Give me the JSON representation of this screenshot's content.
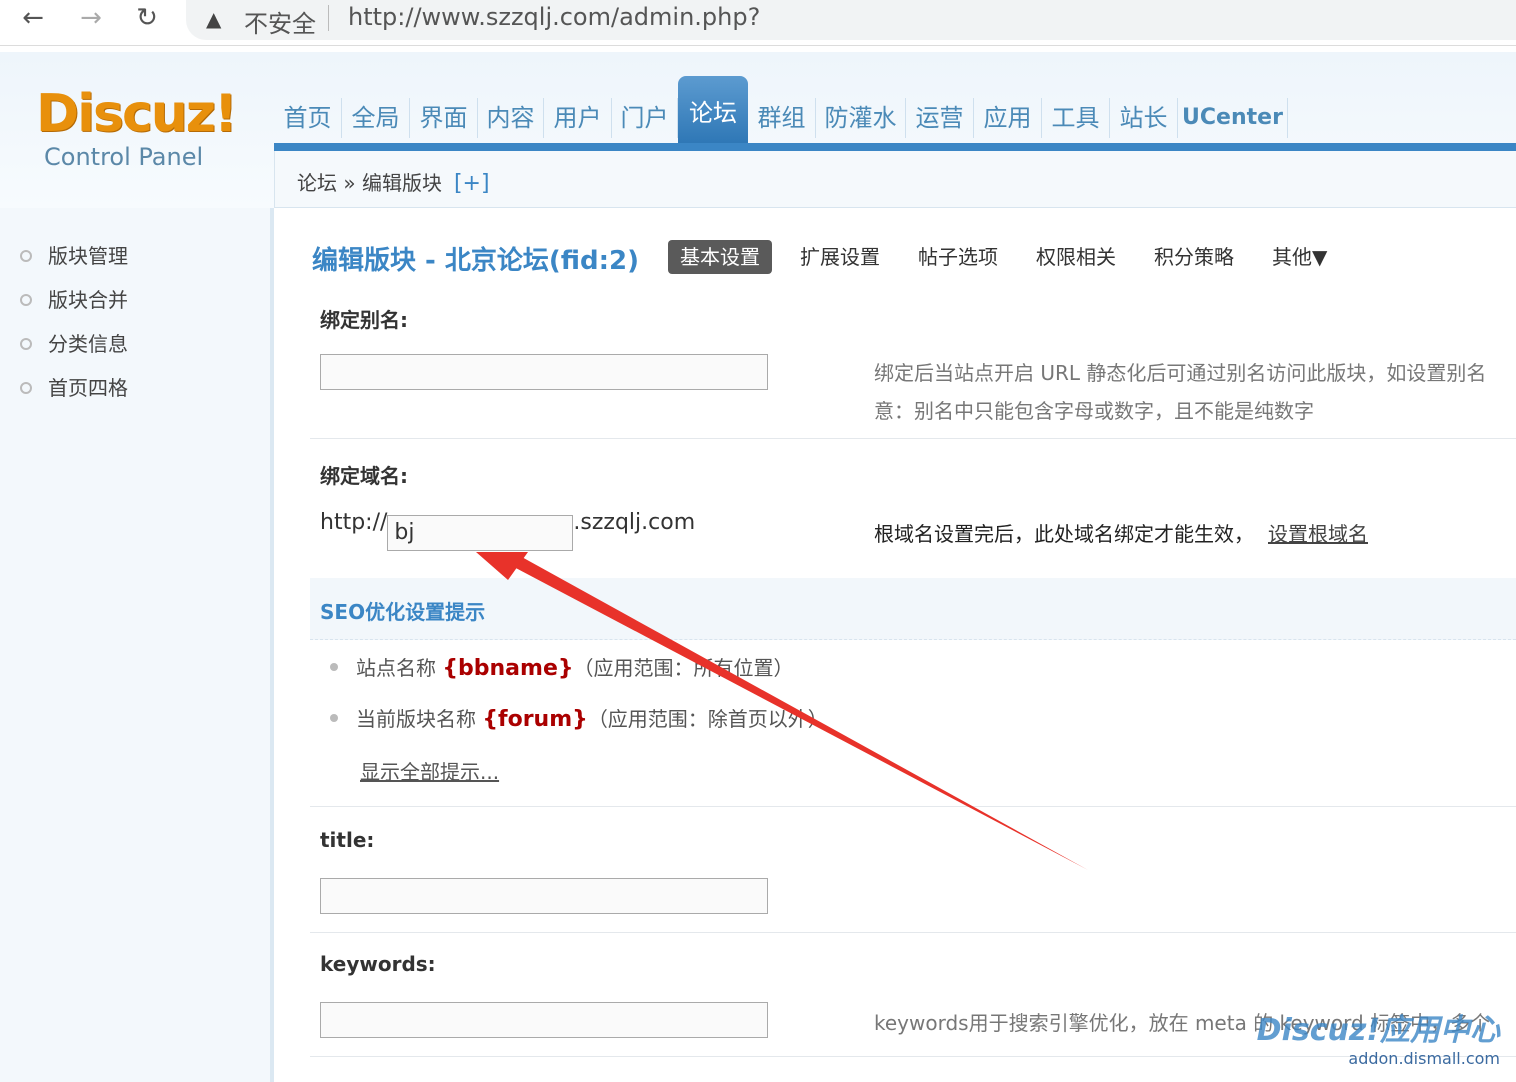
{
  "browser": {
    "security_label": "不安全",
    "url": "http://www.szzqlj.com/admin.php?"
  },
  "header": {
    "brand": "Discuz!",
    "brand_sub": "Control Panel",
    "nav": [
      "首页",
      "全局",
      "界面",
      "内容",
      "用户",
      "门户",
      "论坛",
      "群组",
      "防灌水",
      "运营",
      "应用",
      "工具",
      "站长",
      "UCenter"
    ],
    "nav_active": "论坛",
    "breadcrumb": "论坛 » 编辑版块",
    "breadcrumb_add": "[+]"
  },
  "sidebar": {
    "items": [
      {
        "label": "版块管理"
      },
      {
        "label": "版块合并"
      },
      {
        "label": "分类信息"
      },
      {
        "label": "首页四格"
      }
    ]
  },
  "main": {
    "title": "编辑版块 - 北京论坛(fid:2)",
    "tabs": [
      "基本设置",
      "扩展设置",
      "帖子选项",
      "权限相关",
      "积分策略",
      "其他▼"
    ],
    "alias_label": "绑定别名:",
    "alias_value": "",
    "alias_tip_1": "绑定后当站点开启 URL 静态化后可通过别名访问此版块，如设置别名",
    "alias_tip_2": "意：别名中只能包含字母或数字，且不能是纯数字",
    "domain_label": "绑定域名:",
    "domain_prefix": "http://",
    "domain_value": "bj",
    "domain_suffix": ".szzqlj.com",
    "domain_tip": "根域名设置完后，此处域名绑定才能生效，",
    "domain_link": "设置根域名",
    "seo_title": "SEO优化设置提示",
    "seo_items": [
      {
        "prefix": "站点名称",
        "var": "{bbname}",
        "suffix": "（应用范围：所有位置）"
      },
      {
        "prefix": "当前版块名称",
        "var": "{forum}",
        "suffix": "（应用范围：除首页以外）"
      }
    ],
    "show_all": "显示全部提示...",
    "title_label": "title:",
    "title_value": "",
    "keywords_label": "keywords:",
    "keywords_value": "",
    "keywords_tip": "keywords用于搜索引擎优化，放在 meta 的 keyword 标签中，多个"
  },
  "watermark": {
    "line1": "Discuz!应用中心",
    "line2": "addon.dismall.com"
  },
  "colors": {
    "accent": "#3b86c5",
    "brand": "#e8900c",
    "annotation_arrow": "#e8322a"
  }
}
